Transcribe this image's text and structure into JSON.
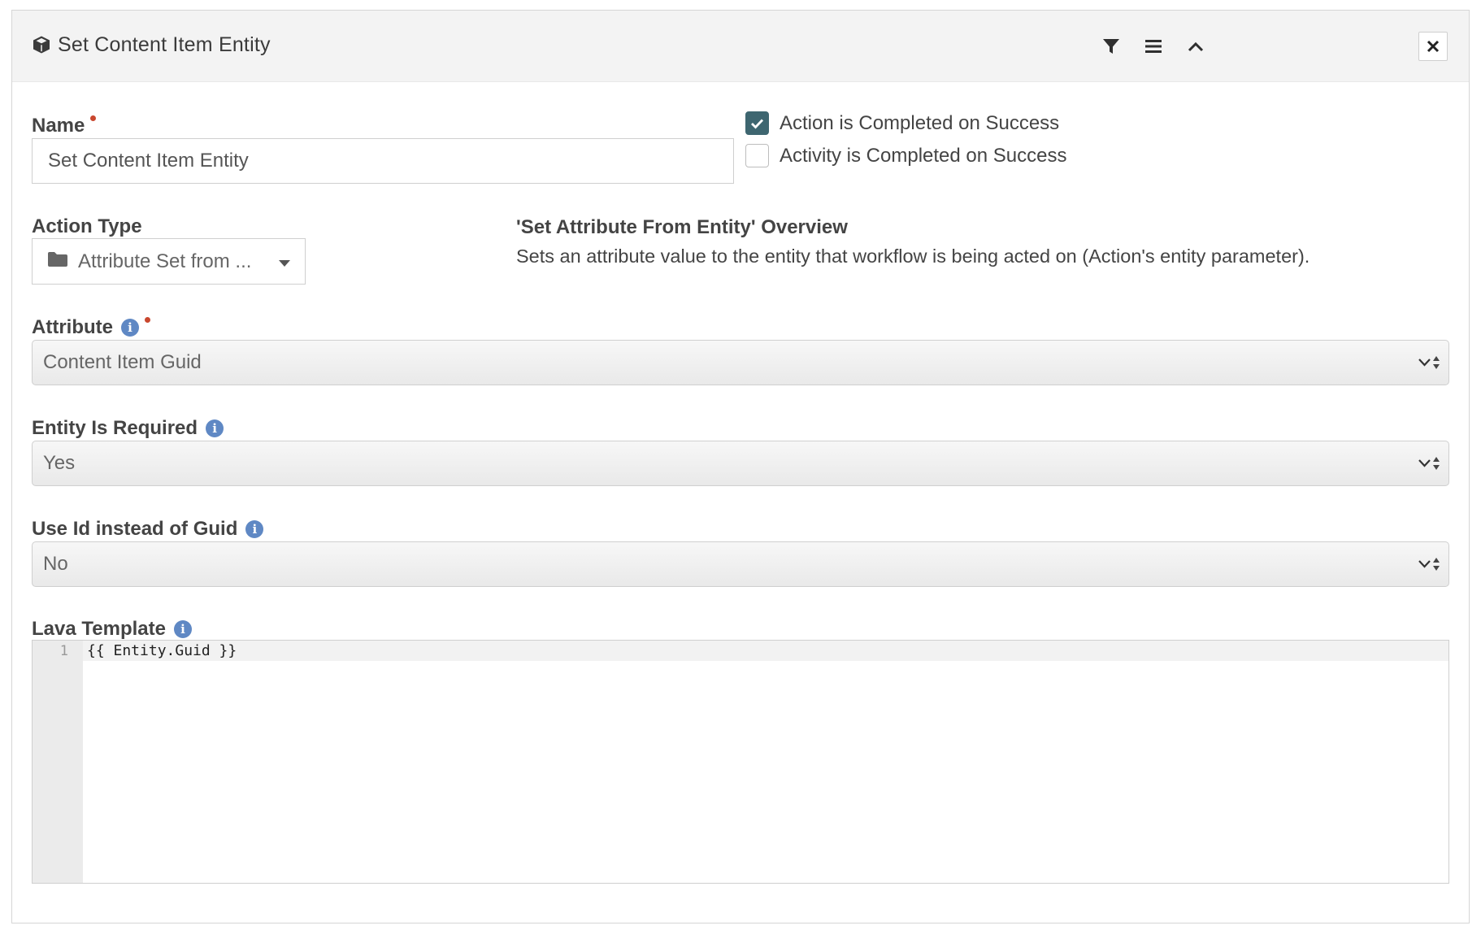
{
  "panel": {
    "title": "Set Content Item Entity",
    "icons": {
      "title_icon": "cube-icon",
      "filter": "filter-icon",
      "menu": "bars-icon",
      "collapse": "chevron-up-icon",
      "close": "close-icon"
    }
  },
  "form": {
    "name_label": "Name",
    "name_value": "Set Content Item Entity",
    "checkbox_action_completed": {
      "label": "Action is Completed on Success",
      "checked": true
    },
    "checkbox_activity_completed": {
      "label": "Activity is Completed on Success",
      "checked": false
    },
    "action_type_label": "Action Type",
    "action_type_value": "Attribute Set from ...",
    "overview_title": "'Set Attribute From Entity' Overview",
    "overview_description": "Sets an attribute value to the entity that workflow is being acted on (Action's entity parameter).",
    "attribute_label": "Attribute",
    "attribute_value": "Content Item Guid",
    "entity_required_label": "Entity Is Required",
    "entity_required_value": "Yes",
    "use_id_label": "Use Id instead of Guid",
    "use_id_value": "No",
    "lava_template_label": "Lava Template",
    "lava_template_line_number": "1",
    "lava_template_code": "{{ Entity.Guid }}"
  },
  "colors": {
    "required_dot": "#c9472e",
    "info_icon": "#5f88c4",
    "checkbox_checked": "#3e6670",
    "header_bg": "#f3f3f3"
  }
}
